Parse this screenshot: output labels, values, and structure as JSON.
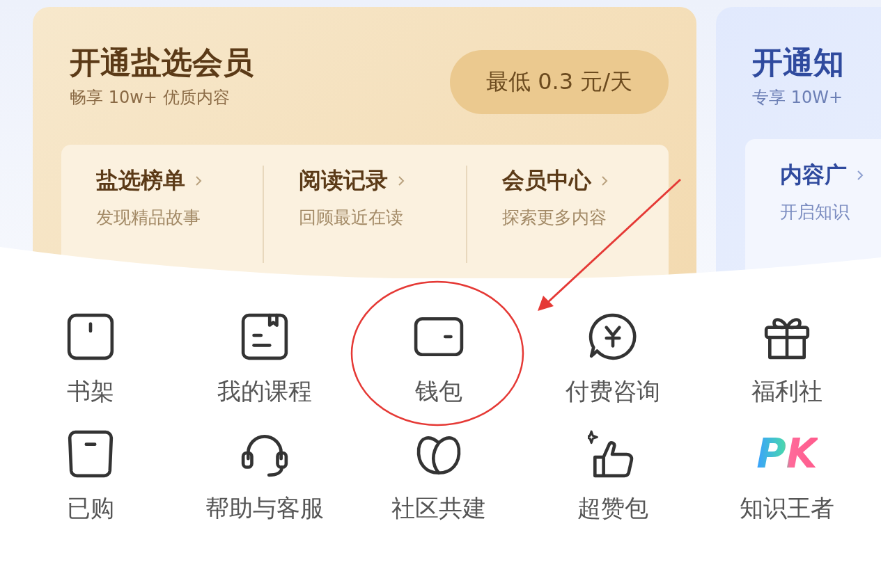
{
  "membership_cards": [
    {
      "kind": "gold",
      "title": "开通盐选会员",
      "subtitle": "畅享 10w+ 优质内容",
      "price_button": "最低 0.3 元/天",
      "links": [
        {
          "title": "盐选榜单",
          "subtitle": "发现精品故事"
        },
        {
          "title": "阅读记录",
          "subtitle": "回顾最近在读"
        },
        {
          "title": "会员中心",
          "subtitle": "探索更多内容"
        }
      ]
    },
    {
      "kind": "blue",
      "title": "开通知",
      "subtitle": "专享 10W+",
      "links": [
        {
          "title": "内容广",
          "subtitle": "开启知识"
        }
      ]
    }
  ],
  "menu_items": [
    {
      "label": "书架"
    },
    {
      "label": "我的课程"
    },
    {
      "label": "钱包"
    },
    {
      "label": "付费咨询"
    },
    {
      "label": "福利社"
    },
    {
      "label": "已购"
    },
    {
      "label": "帮助与客服"
    },
    {
      "label": "社区共建"
    },
    {
      "label": "超赞包"
    },
    {
      "label": "知识王者",
      "logo_text": "PK"
    }
  ]
}
